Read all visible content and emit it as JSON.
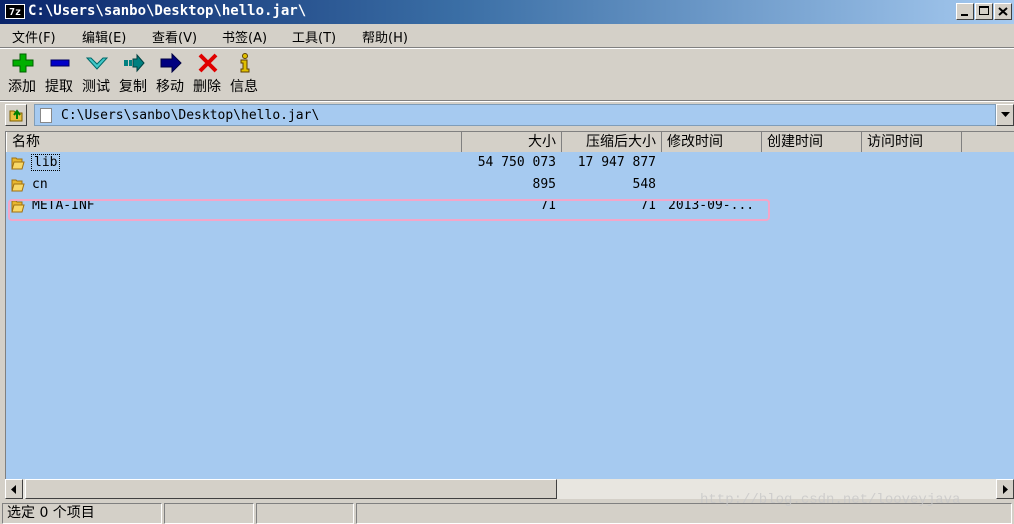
{
  "window": {
    "title": "C:\\Users\\sanbo\\Desktop\\hello.jar\\",
    "icon_text": "7z",
    "controls": [
      "minimize",
      "maximize",
      "close"
    ]
  },
  "menu": {
    "items": [
      "文件(F)",
      "编辑(E)",
      "查看(V)",
      "书签(A)",
      "工具(T)",
      "帮助(H)"
    ]
  },
  "toolbar": {
    "buttons": [
      {
        "label": "添加",
        "icon": "plus-icon",
        "color": "#00a000"
      },
      {
        "label": "提取",
        "icon": "minus-icon",
        "color": "#0000c0"
      },
      {
        "label": "测试",
        "icon": "check-icon",
        "color": "#00a0a0"
      },
      {
        "label": "复制",
        "icon": "double-arrow-icon",
        "color": "#008080"
      },
      {
        "label": "移动",
        "icon": "arrow-icon",
        "color": "#000080"
      },
      {
        "label": "删除",
        "icon": "delete-x-icon",
        "color": "#e00000"
      },
      {
        "label": "信息",
        "icon": "info-icon",
        "color": "#e0c000"
      }
    ]
  },
  "address": {
    "path": "C:\\Users\\sanbo\\Desktop\\hello.jar\\"
  },
  "columns": {
    "name": "名称",
    "size": "大小",
    "packed": "压缩后大小",
    "modified": "修改时间",
    "created": "创建时间",
    "accessed": "访问时间"
  },
  "files": [
    {
      "name": "lib",
      "size": "54 750 073",
      "packed": "17 947 877",
      "modified": ""
    },
    {
      "name": "cn",
      "size": "895",
      "packed": "548",
      "modified": ""
    },
    {
      "name": "META-INF",
      "size": "71",
      "packed": "71",
      "modified": "2013-09-..."
    }
  ],
  "status": {
    "text": "选定 0 个项目"
  },
  "watermark": "http://blog.csdn.net/looveyjava",
  "colors": {
    "list_bg": "#a6caf0",
    "highlight": "#f4a6c8",
    "folder": "#e8b830"
  }
}
